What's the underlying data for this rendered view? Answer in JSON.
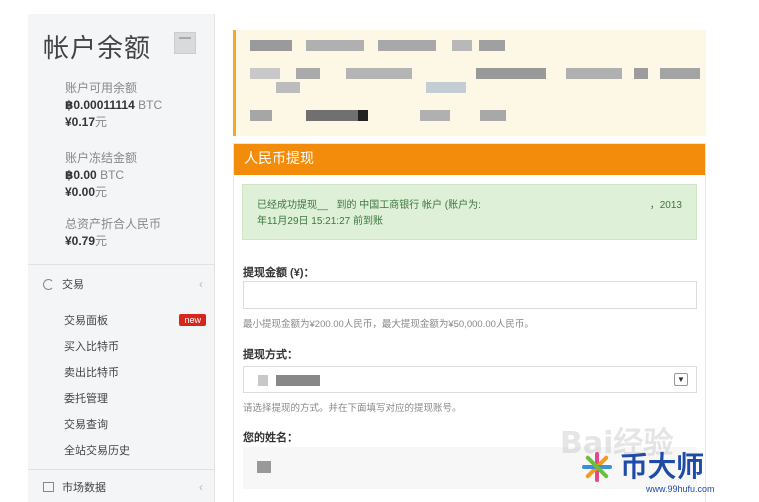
{
  "sidebar": {
    "title": "帐户余额",
    "available_label": "账户可用余额",
    "available_btc": "฿0.00011114",
    "available_btc_unit": "BTC",
    "available_cny": "¥0.17",
    "available_cny_unit": "元",
    "frozen_label": "账户冻结金额",
    "frozen_btc": "฿0.00",
    "frozen_btc_unit": "BTC",
    "frozen_cny": "¥0.00",
    "frozen_cny_unit": "元",
    "total_label": "总资产折合人民币",
    "total_cny": "¥0.79",
    "total_cny_unit": "元",
    "trade_section": "交易",
    "trade_items": [
      {
        "label": "交易面板",
        "badge": "new"
      },
      {
        "label": "买入比特币"
      },
      {
        "label": "卖出比特币"
      },
      {
        "label": "委托管理"
      },
      {
        "label": "交易查询"
      },
      {
        "label": "全站交易历史"
      }
    ],
    "market_section": "市场数据",
    "chevron": "‹"
  },
  "panel": {
    "title": "人民币提现",
    "success_line1": "已经成功提现",
    "success_line1b": "到的 中国工商银行 帐户 (账户为:",
    "success_date_start": "，2013",
    "success_line2": "年11月29日 15:21:27 前到账",
    "amount_label": "提现金额 (¥)：",
    "amount_value": "",
    "amount_help": "最小提现金额为¥200.00人民币，最大提现金额为¥50,000.00人民币。",
    "method_label": "提现方式：",
    "method_caret": "▼",
    "method_help": "请选择提现的方式。并在下面填写对应的提现账号。",
    "name_label": "您的姓名："
  },
  "watermark": {
    "brand": "币大师",
    "url": "www.99hufu.com",
    "baidu": "Bai经验"
  },
  "colors": {
    "accent_orange": "#f28c0a",
    "success_bg": "#dff0d8",
    "notice_bg": "#fdf7e6",
    "badge_red": "#d9261c",
    "brand_blue": "#1e4aa8"
  }
}
